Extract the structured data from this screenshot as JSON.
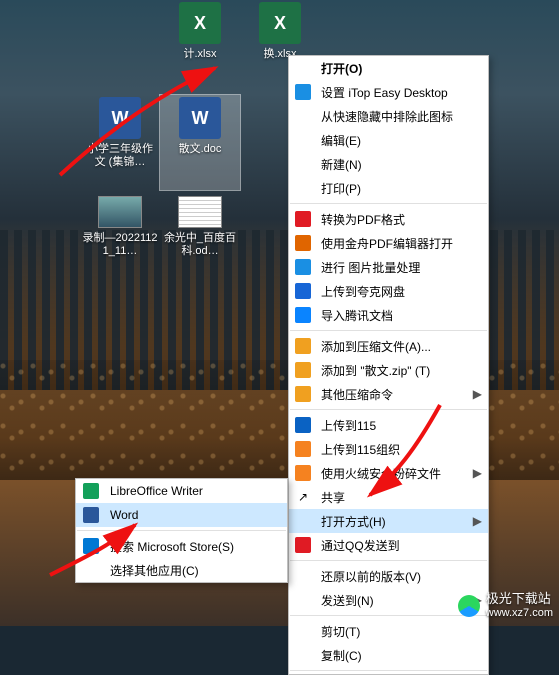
{
  "desktop": {
    "row1": [
      {
        "name": "",
        "type": ""
      },
      {
        "name": "",
        "type": ""
      },
      {
        "name": "计.xlsx",
        "type": "xl"
      },
      {
        "name": "换.xlsx",
        "type": "xl"
      },
      {
        "name": "",
        "type": ""
      }
    ],
    "row2": [
      {
        "name": "",
        "type": ""
      },
      {
        "name": "小学三年级作文 (集锦…",
        "type": "word"
      },
      {
        "name": "散文.doc",
        "type": "word",
        "selected": true
      },
      {
        "name": "",
        "type": "word_hidden"
      },
      {
        "name": "",
        "type": "unk_hidden"
      }
    ],
    "row3": [
      {
        "name": "",
        "type": ""
      },
      {
        "name": "录制—20221121_11…",
        "type": "thumb"
      },
      {
        "name": "余光中_百度百科.od…",
        "type": "thumb"
      },
      {
        "name": "",
        "type": ""
      },
      {
        "name": "",
        "type": ""
      }
    ]
  },
  "context_menu": {
    "items": [
      {
        "icon": "",
        "label": "打开(O)",
        "bold": true
      },
      {
        "icon": "itop",
        "label": "设置 iTop Easy Desktop"
      },
      {
        "icon": "",
        "label": "从快速隐藏中排除此图标"
      },
      {
        "icon": "",
        "label": "编辑(E)"
      },
      {
        "icon": "",
        "label": "新建(N)"
      },
      {
        "icon": "",
        "label": "打印(P)"
      },
      {
        "sep": true
      },
      {
        "icon": "pdf",
        "label": "转换为PDF格式"
      },
      {
        "icon": "pdfed",
        "label": "使用金舟PDF编辑器打开"
      },
      {
        "icon": "img",
        "label": "进行 图片批量处理"
      },
      {
        "icon": "kk",
        "label": "上传到夸克网盘"
      },
      {
        "icon": "tx",
        "label": "导入腾讯文档"
      },
      {
        "sep": true
      },
      {
        "icon": "zip",
        "label": "添加到压缩文件(A)..."
      },
      {
        "icon": "zip",
        "label": "添加到 \"散文.zip\" (T)"
      },
      {
        "icon": "zip",
        "label": "其他压缩命令",
        "arrow": true
      },
      {
        "sep": true
      },
      {
        "icon": "115",
        "label": "上传到115"
      },
      {
        "icon": "115o",
        "label": "上传到115组织"
      },
      {
        "icon": "hr",
        "label": "使用火绒安全粉碎文件",
        "arrow": true
      },
      {
        "icon": "share",
        "label": "共享"
      },
      {
        "icon": "",
        "label": "打开方式(H)",
        "arrow": true,
        "hl": true
      },
      {
        "icon": "qq",
        "label": "通过QQ发送到"
      },
      {
        "sep": true
      },
      {
        "icon": "",
        "label": "还原以前的版本(V)"
      },
      {
        "icon": "",
        "label": "发送到(N)",
        "arrow": true
      },
      {
        "sep": true
      },
      {
        "icon": "",
        "label": "剪切(T)"
      },
      {
        "icon": "",
        "label": "复制(C)"
      },
      {
        "sep": true
      }
    ]
  },
  "openwith_menu": {
    "items": [
      {
        "icon": "lo",
        "label": "LibreOffice Writer"
      },
      {
        "icon": "wd",
        "label": "Word",
        "hl": true
      },
      {
        "sep": true
      },
      {
        "icon": "ms",
        "label": "搜索 Microsoft Store(S)"
      },
      {
        "icon": "",
        "label": "选择其他应用(C)"
      }
    ]
  },
  "watermark": {
    "title": "极光下载站",
    "url": "www.xz7.com"
  }
}
